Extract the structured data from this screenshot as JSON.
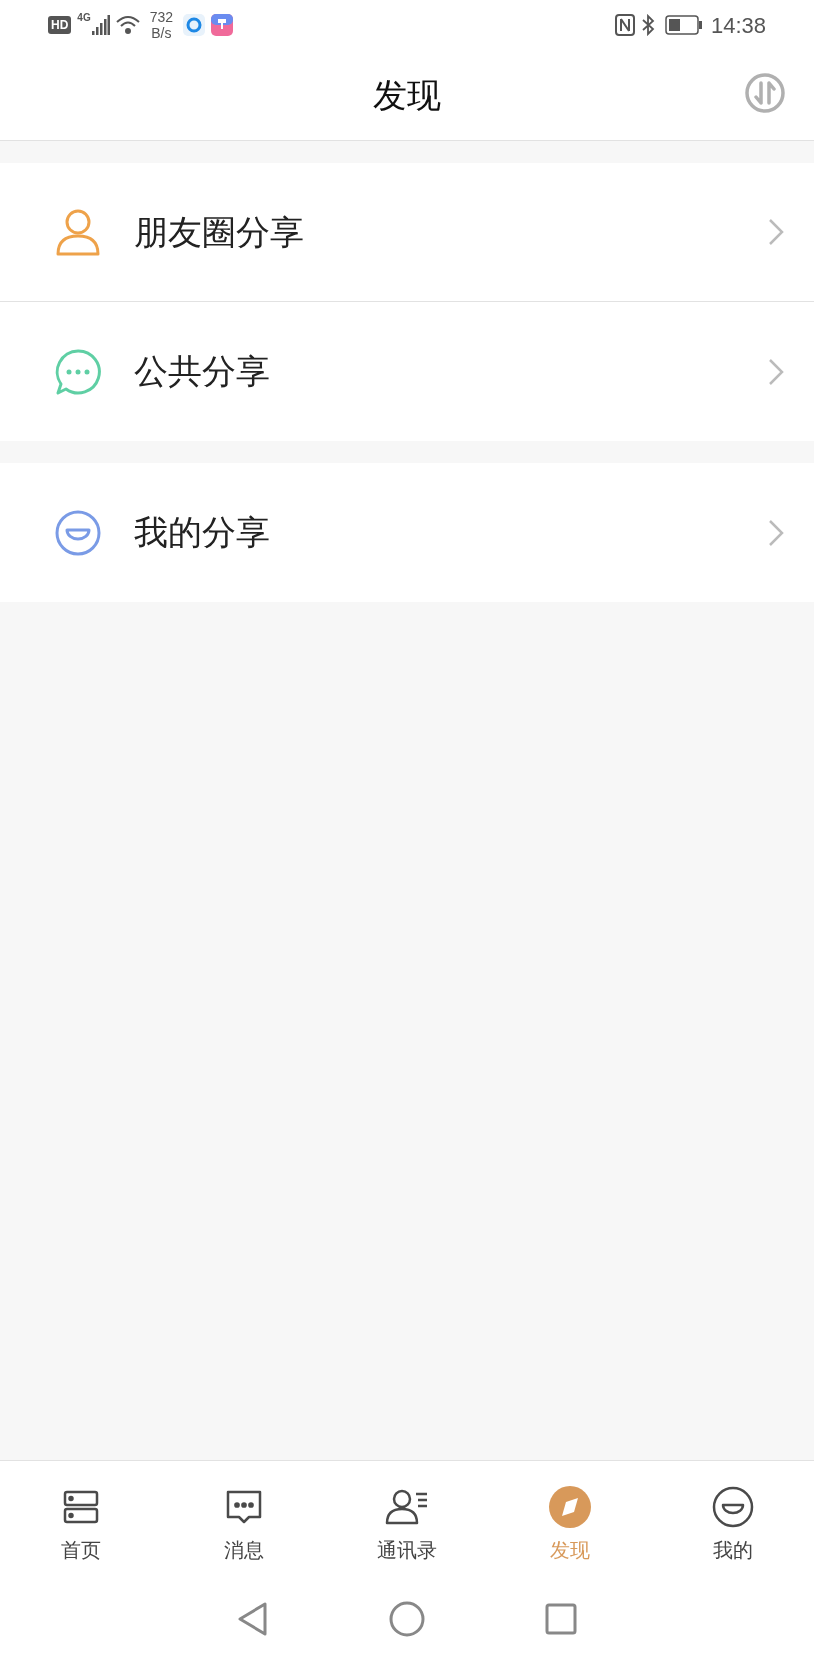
{
  "status_bar": {
    "hd": "HD",
    "network": "4G",
    "speed": "732",
    "speed_unit": "B/s",
    "time": "14:38"
  },
  "header": {
    "title": "发现"
  },
  "groups": [
    {
      "items": [
        {
          "label": "朋友圈分享",
          "kind": "person"
        },
        {
          "label": "公共分享",
          "kind": "chat"
        }
      ]
    },
    {
      "items": [
        {
          "label": "我的分享",
          "kind": "smile"
        }
      ]
    }
  ],
  "tabs": [
    {
      "label": "首页",
      "kind": "home",
      "selected": false
    },
    {
      "label": "消息",
      "kind": "message",
      "selected": false
    },
    {
      "label": "通讯录",
      "kind": "contacts",
      "selected": false
    },
    {
      "label": "发现",
      "kind": "discover",
      "selected": true
    },
    {
      "label": "我的",
      "kind": "me",
      "selected": false
    }
  ]
}
